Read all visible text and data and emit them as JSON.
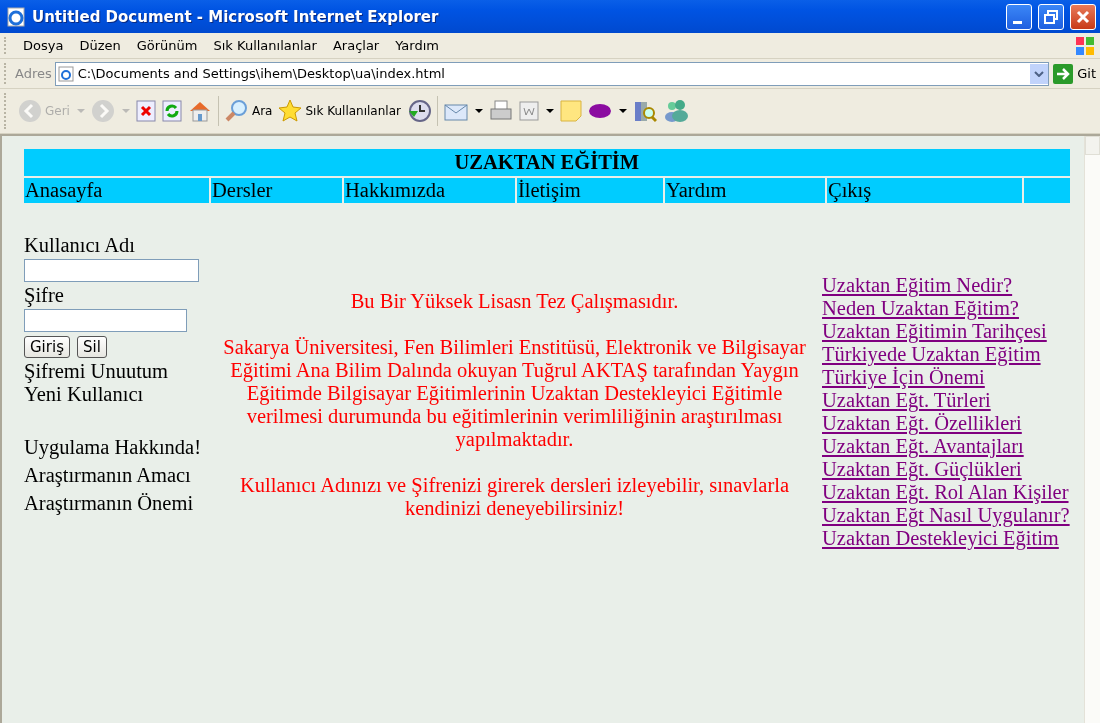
{
  "window": {
    "title": "Untitled Document - Microsoft Internet Explorer"
  },
  "menu": [
    "Dosya",
    "Düzen",
    "Görünüm",
    "Sık Kullanılanlar",
    "Araçlar",
    "Yardım"
  ],
  "address": {
    "label": "Adres",
    "value": "C:\\Documents and Settings\\ihem\\Desktop\\ua\\index.html",
    "go": "Git"
  },
  "toolbar": [
    {
      "kind": "back",
      "label": "Geri",
      "disabled": true,
      "dropdown": true
    },
    {
      "kind": "forward",
      "disabled": true,
      "dropdown": true
    },
    {
      "kind": "stop",
      "disabled": false,
      "dropdown": false
    },
    {
      "kind": "refresh",
      "disabled": false,
      "dropdown": false
    },
    {
      "kind": "home",
      "disabled": false,
      "dropdown": false
    },
    {
      "kind": "search",
      "label": "Ara",
      "disabled": false,
      "dropdown": false
    },
    {
      "kind": "favorites",
      "label": "Sık Kullanılanlar",
      "disabled": false,
      "dropdown": false
    },
    {
      "kind": "history",
      "disabled": false,
      "dropdown": false
    },
    {
      "kind": "mail",
      "disabled": false,
      "dropdown": true
    },
    {
      "kind": "print",
      "disabled": false,
      "dropdown": false
    },
    {
      "kind": "word",
      "disabled": false,
      "dropdown": true
    },
    {
      "kind": "note",
      "disabled": false,
      "dropdown": false
    },
    {
      "kind": "yahoo",
      "disabled": false,
      "dropdown": true
    },
    {
      "kind": "research",
      "disabled": false,
      "dropdown": false
    },
    {
      "kind": "messenger",
      "disabled": false,
      "dropdown": false
    }
  ],
  "page": {
    "header": "UZAKTAN EĞİTİM",
    "nav": [
      "Anasayfa",
      "Dersler",
      "Hakkımızda",
      "İletişim",
      "Yardım",
      "Çıkış"
    ],
    "login": {
      "username_label": "Kullanıcı Adı",
      "password_label": "Şifre",
      "buttons": [
        "Giriş",
        "Sil"
      ],
      "links": [
        "Şifremi Unuutum",
        "Yeni Kullanıcı"
      ]
    },
    "info_links": [
      "Uygulama Hakkında!",
      "Araştırmanın Amacı",
      "Araştırmanın Önemi"
    ],
    "paragraphs": [
      "Bu Bir Yüksek Lisasn Tez Çalışmasıdır.",
      "Sakarya Üniversitesi, Fen Bilimleri Enstitüsü, Elektronik ve Bilgisayar Eğitimi Ana Bilim Dalında okuyan Tuğrul AKTAŞ tarafından Yaygın Eğitimde Bilgisayar Eğitimlerinin Uzaktan Destekleyici Eğitimle verilmesi durumunda bu eğitimlerinin verimliliğinin araştırılması yapılmaktadır.",
      "Kullanıcı Adınızı ve Şifrenizi girerek dersleri izleyebilir, sınavlarla kendinizi deneyebilirsiniz!"
    ],
    "topic_links": [
      "Uzaktan Eğitim Nedir?",
      "Neden Uzaktan Eğitim?",
      "Uzaktan Eğitimin Tarihçesi",
      "Türkiyede Uzaktan Eğitim",
      "Türkiye İçin Önemi",
      "Uzaktan Eğt. Türleri",
      "Uzaktan Eğt. Özellikleri",
      "Uzaktan Eğt. Avantajları",
      "Uzaktan Eğt. Güçlükleri",
      "Uzaktan Eğt. Rol Alan Kişiler",
      "Uzaktan Eğt Nasıl Uygulanır?",
      "Uzaktan Destekleyici Eğitim"
    ]
  }
}
